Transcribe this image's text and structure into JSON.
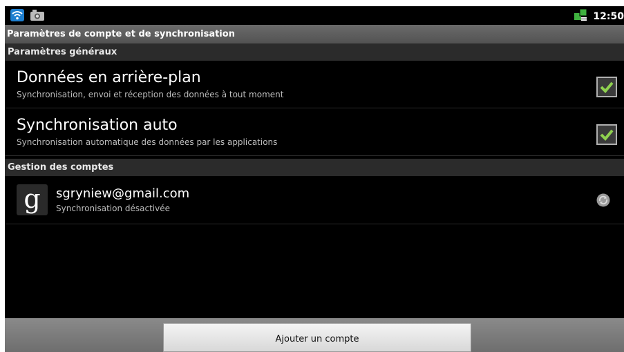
{
  "status_bar": {
    "left_icons": [
      "wifi-icon",
      "camera-icon"
    ],
    "right_icon": "network-icon",
    "time": "12:50"
  },
  "title_bar": {
    "title": "Paramètres de compte et de synchronisation"
  },
  "general_settings": {
    "header": "Paramètres généraux",
    "items": [
      {
        "title": "Données en arrière-plan",
        "summary": "Synchronisation, envoi et réception des données à tout moment",
        "checked": true
      },
      {
        "title": "Synchronisation auto",
        "summary": "Synchronisation automatique des données par les applications",
        "checked": true
      }
    ]
  },
  "account_management": {
    "header": "Gestion des comptes",
    "accounts": [
      {
        "icon": "google-icon",
        "icon_glyph": "g",
        "email": "sgryniew@gmail.com",
        "status": "Synchronisation désactivée",
        "sync_icon": "sync-icon"
      }
    ]
  },
  "bottom_bar": {
    "add_account_label": "Ajouter un compte"
  },
  "colors": {
    "accent_check": "#8fd14f",
    "title_bar": "#5e5e5e",
    "section_header": "#2b2b2b"
  }
}
